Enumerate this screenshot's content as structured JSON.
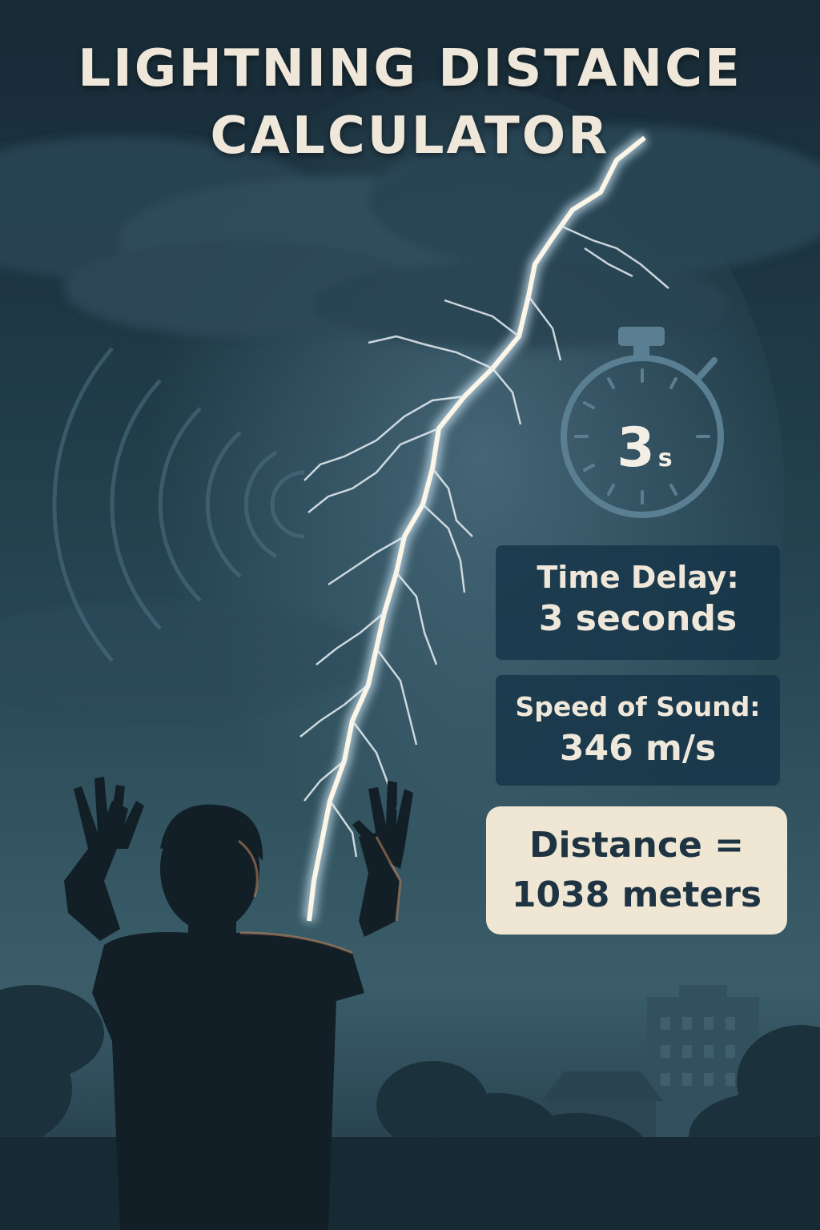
{
  "title": {
    "line1": "LIGHTNING DISTANCE",
    "line2": "CALCULATOR"
  },
  "stopwatch": {
    "value": "3",
    "unit": "s"
  },
  "time_delay": {
    "label": "Time Delay:",
    "value": "3 seconds"
  },
  "speed_of_sound": {
    "label": "Speed of Sound:",
    "value": "346 m/s"
  },
  "result": {
    "label": "Distance =",
    "value": "1038 meters"
  },
  "colors": {
    "sky_top": "#1a2d3a",
    "sky_bottom": "#2a4a5e",
    "card_bg": "#163448",
    "result_bg": "#efe6d3",
    "text_light": "#efe8da",
    "text_dark": "#1f3443",
    "lightning": "#fbf6e8"
  }
}
